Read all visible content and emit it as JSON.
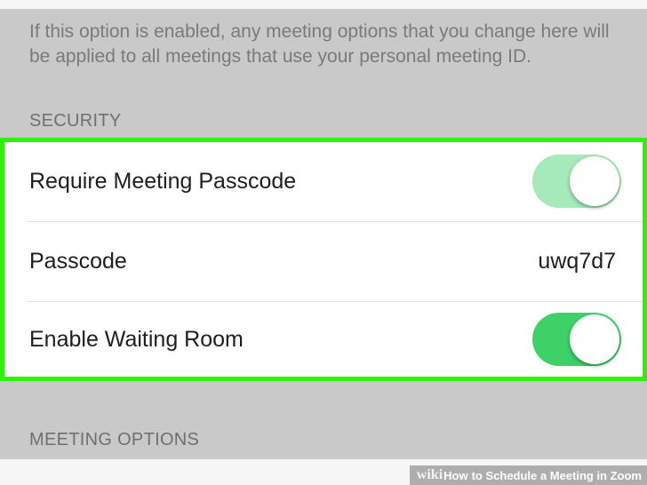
{
  "info": {
    "text": "If this option is enabled, any meeting options that you change here will be applied to all meetings that use your personal meeting ID."
  },
  "security": {
    "header": "SECURITY",
    "rows": [
      {
        "label": "Require Meeting Passcode",
        "toggle_state": "on-light"
      },
      {
        "label": "Passcode",
        "value": "uwq7d7"
      },
      {
        "label": "Enable Waiting Room",
        "toggle_state": "on"
      }
    ]
  },
  "meeting_options": {
    "header": "MEETING OPTIONS"
  },
  "watermark": {
    "brand": "wiki",
    "how": "How",
    "title": "to Schedule a Meeting in Zoom"
  },
  "colors": {
    "highlight": "#2cf300",
    "toggle_light": "#a6e9ba",
    "toggle_on": "#3dd168"
  }
}
